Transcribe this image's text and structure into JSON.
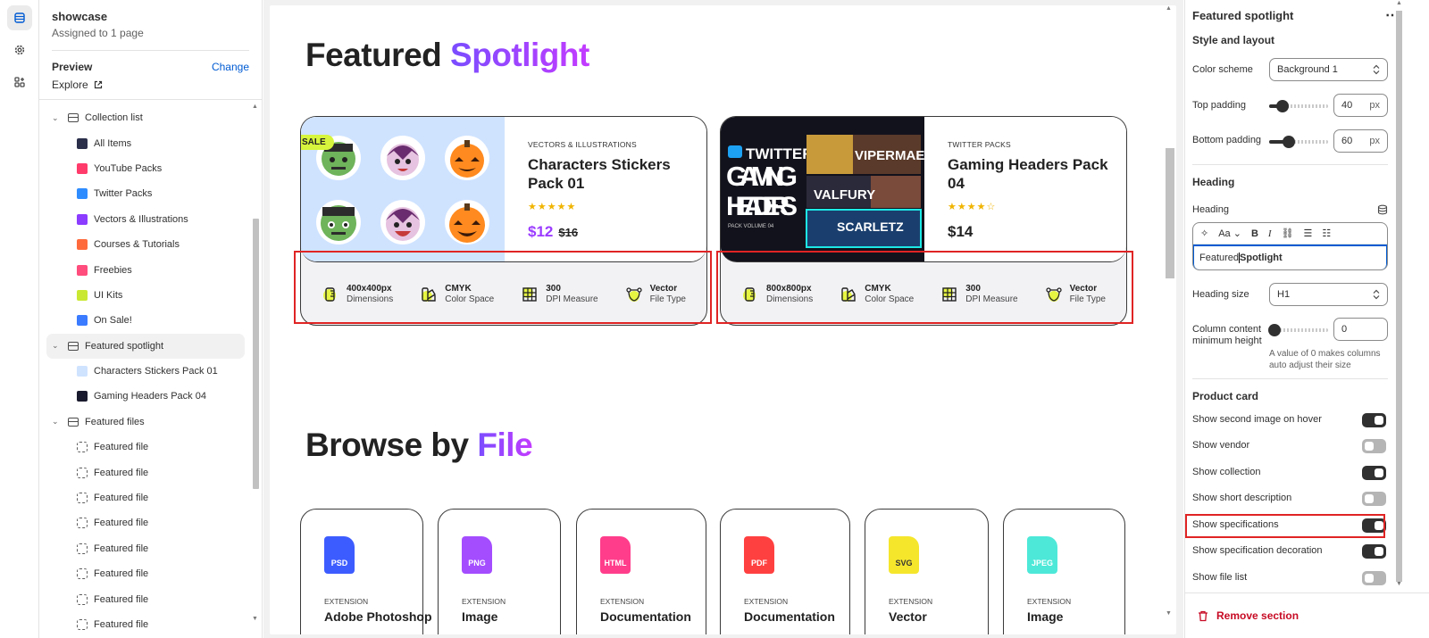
{
  "sidebar": {
    "title": "showcase",
    "subtitle": "Assigned to 1 page",
    "preview_label": "Preview",
    "change_label": "Change",
    "explore_label": "Explore",
    "tree": [
      {
        "kind": "group",
        "label": "Collection list"
      },
      {
        "kind": "child",
        "label": "All Items",
        "thumb": "#2b2f4a"
      },
      {
        "kind": "child",
        "label": "YouTube Packs",
        "thumb": "#ff3b6b"
      },
      {
        "kind": "child",
        "label": "Twitter Packs",
        "thumb": "#2f8cff"
      },
      {
        "kind": "child",
        "label": "Vectors & Illustrations",
        "thumb": "#8b3cff"
      },
      {
        "kind": "child",
        "label": "Courses & Tutorials",
        "thumb": "#ff6a3c"
      },
      {
        "kind": "child",
        "label": "Freebies",
        "thumb": "#ff4d7d"
      },
      {
        "kind": "child",
        "label": "UI Kits",
        "thumb": "#c9e832"
      },
      {
        "kind": "child",
        "label": "On Sale!",
        "thumb": "#3a7bff"
      },
      {
        "kind": "group",
        "label": "Featured spotlight",
        "selected": true
      },
      {
        "kind": "child",
        "label": "Characters Stickers Pack 01",
        "thumb": "#cfe3ff"
      },
      {
        "kind": "child",
        "label": "Gaming Headers Pack 04",
        "thumb": "#1a1a2e"
      },
      {
        "kind": "group",
        "label": "Featured files"
      },
      {
        "kind": "file",
        "label": "Featured file"
      },
      {
        "kind": "file",
        "label": "Featured file"
      },
      {
        "kind": "file",
        "label": "Featured file"
      },
      {
        "kind": "file",
        "label": "Featured file"
      },
      {
        "kind": "file",
        "label": "Featured file"
      },
      {
        "kind": "file",
        "label": "Featured file"
      },
      {
        "kind": "file",
        "label": "Featured file"
      },
      {
        "kind": "file",
        "label": "Featured file"
      }
    ]
  },
  "preview": {
    "heading_plain": "Featured ",
    "heading_accent": "Spotlight",
    "cards": [
      {
        "category": "VECTORS & ILLUSTRATIONS",
        "title": "Characters Stickers Pack 01",
        "stars": "★★★★★",
        "price": "$12",
        "compare_price": "$16",
        "badge": "SALE",
        "specs": [
          {
            "value": "400x400px",
            "label": "Dimensions",
            "icon": "ruler-icon"
          },
          {
            "value": "CMYK",
            "label": "Color Space",
            "icon": "palette-icon"
          },
          {
            "value": "300",
            "label": "DPI Measure",
            "icon": "grid-icon"
          },
          {
            "value": "Vector",
            "label": "File Type",
            "icon": "vector-icon"
          }
        ]
      },
      {
        "category": "TWITTER PACKS",
        "title": "Gaming Headers Pack 04",
        "stars": "★★★★☆",
        "price": "$14",
        "image_text": [
          "TWITTER",
          "GAMING",
          "HEADERS",
          "PACK VOLUME 04",
          "VIPERMAE",
          "VALFURY",
          "SCARLETZ"
        ],
        "specs": [
          {
            "value": "800x800px",
            "label": "Dimensions",
            "icon": "ruler-icon"
          },
          {
            "value": "CMYK",
            "label": "Color Space",
            "icon": "palette-icon"
          },
          {
            "value": "300",
            "label": "DPI Measure",
            "icon": "grid-icon"
          },
          {
            "value": "Vector",
            "label": "File Type",
            "icon": "vector-icon"
          }
        ]
      }
    ],
    "browse_plain": "Browse by ",
    "browse_accent": "File",
    "files": [
      {
        "ext": "PSD",
        "label": "EXTENSION",
        "name": "Adobe Photoshop",
        "color": "#3d5cff"
      },
      {
        "ext": "PNG",
        "label": "EXTENSION",
        "name": "Image",
        "color": "#a44dff"
      },
      {
        "ext": "HTML",
        "label": "EXTENSION",
        "name": "Documentation",
        "color": "#ff3d8b"
      },
      {
        "ext": "PDF",
        "label": "EXTENSION",
        "name": "Documentation",
        "color": "#ff4040"
      },
      {
        "ext": "SVG",
        "label": "EXTENSION",
        "name": "Vector",
        "color": "#f5e62c"
      },
      {
        "ext": "JPEG",
        "label": "EXTENSION",
        "name": "Image",
        "color": "#4de8d8"
      }
    ]
  },
  "settings": {
    "title": "Featured spotlight",
    "more_icon": "⋯",
    "style_layout": "Style and layout",
    "color_scheme_label": "Color scheme",
    "color_scheme_value": "Background 1",
    "top_padding_label": "Top padding",
    "top_padding_value": "40",
    "top_padding_fraction": 0.22,
    "bottom_padding_label": "Bottom padding",
    "bottom_padding_value": "60",
    "bottom_padding_fraction": 0.33,
    "px_unit": "px",
    "heading_section": "Heading",
    "heading_label": "Heading",
    "heading_plain": "Featured ",
    "heading_bold": "Spotlight",
    "heading_size_label": "Heading size",
    "heading_size_value": "H1",
    "col_height_label": "Column content minimum height",
    "col_height_value": "0",
    "col_height_hint": "A value of 0 makes columns auto adjust their size",
    "product_card": "Product card",
    "toggles": [
      {
        "label": "Show second image on hover",
        "on": true
      },
      {
        "label": "Show vendor",
        "on": false
      },
      {
        "label": "Show collection",
        "on": true
      },
      {
        "label": "Show short description",
        "on": false
      },
      {
        "label": "Show specifications",
        "on": true
      },
      {
        "label": "Show specification decoration",
        "on": true
      },
      {
        "label": "Show file list",
        "on": false
      }
    ],
    "remove_label": "Remove section"
  },
  "colors": {
    "accent_blue": "#005bd3",
    "highlight_red": "#e02424",
    "brand_purple": "#9b3cff",
    "danger": "#c70a24"
  }
}
